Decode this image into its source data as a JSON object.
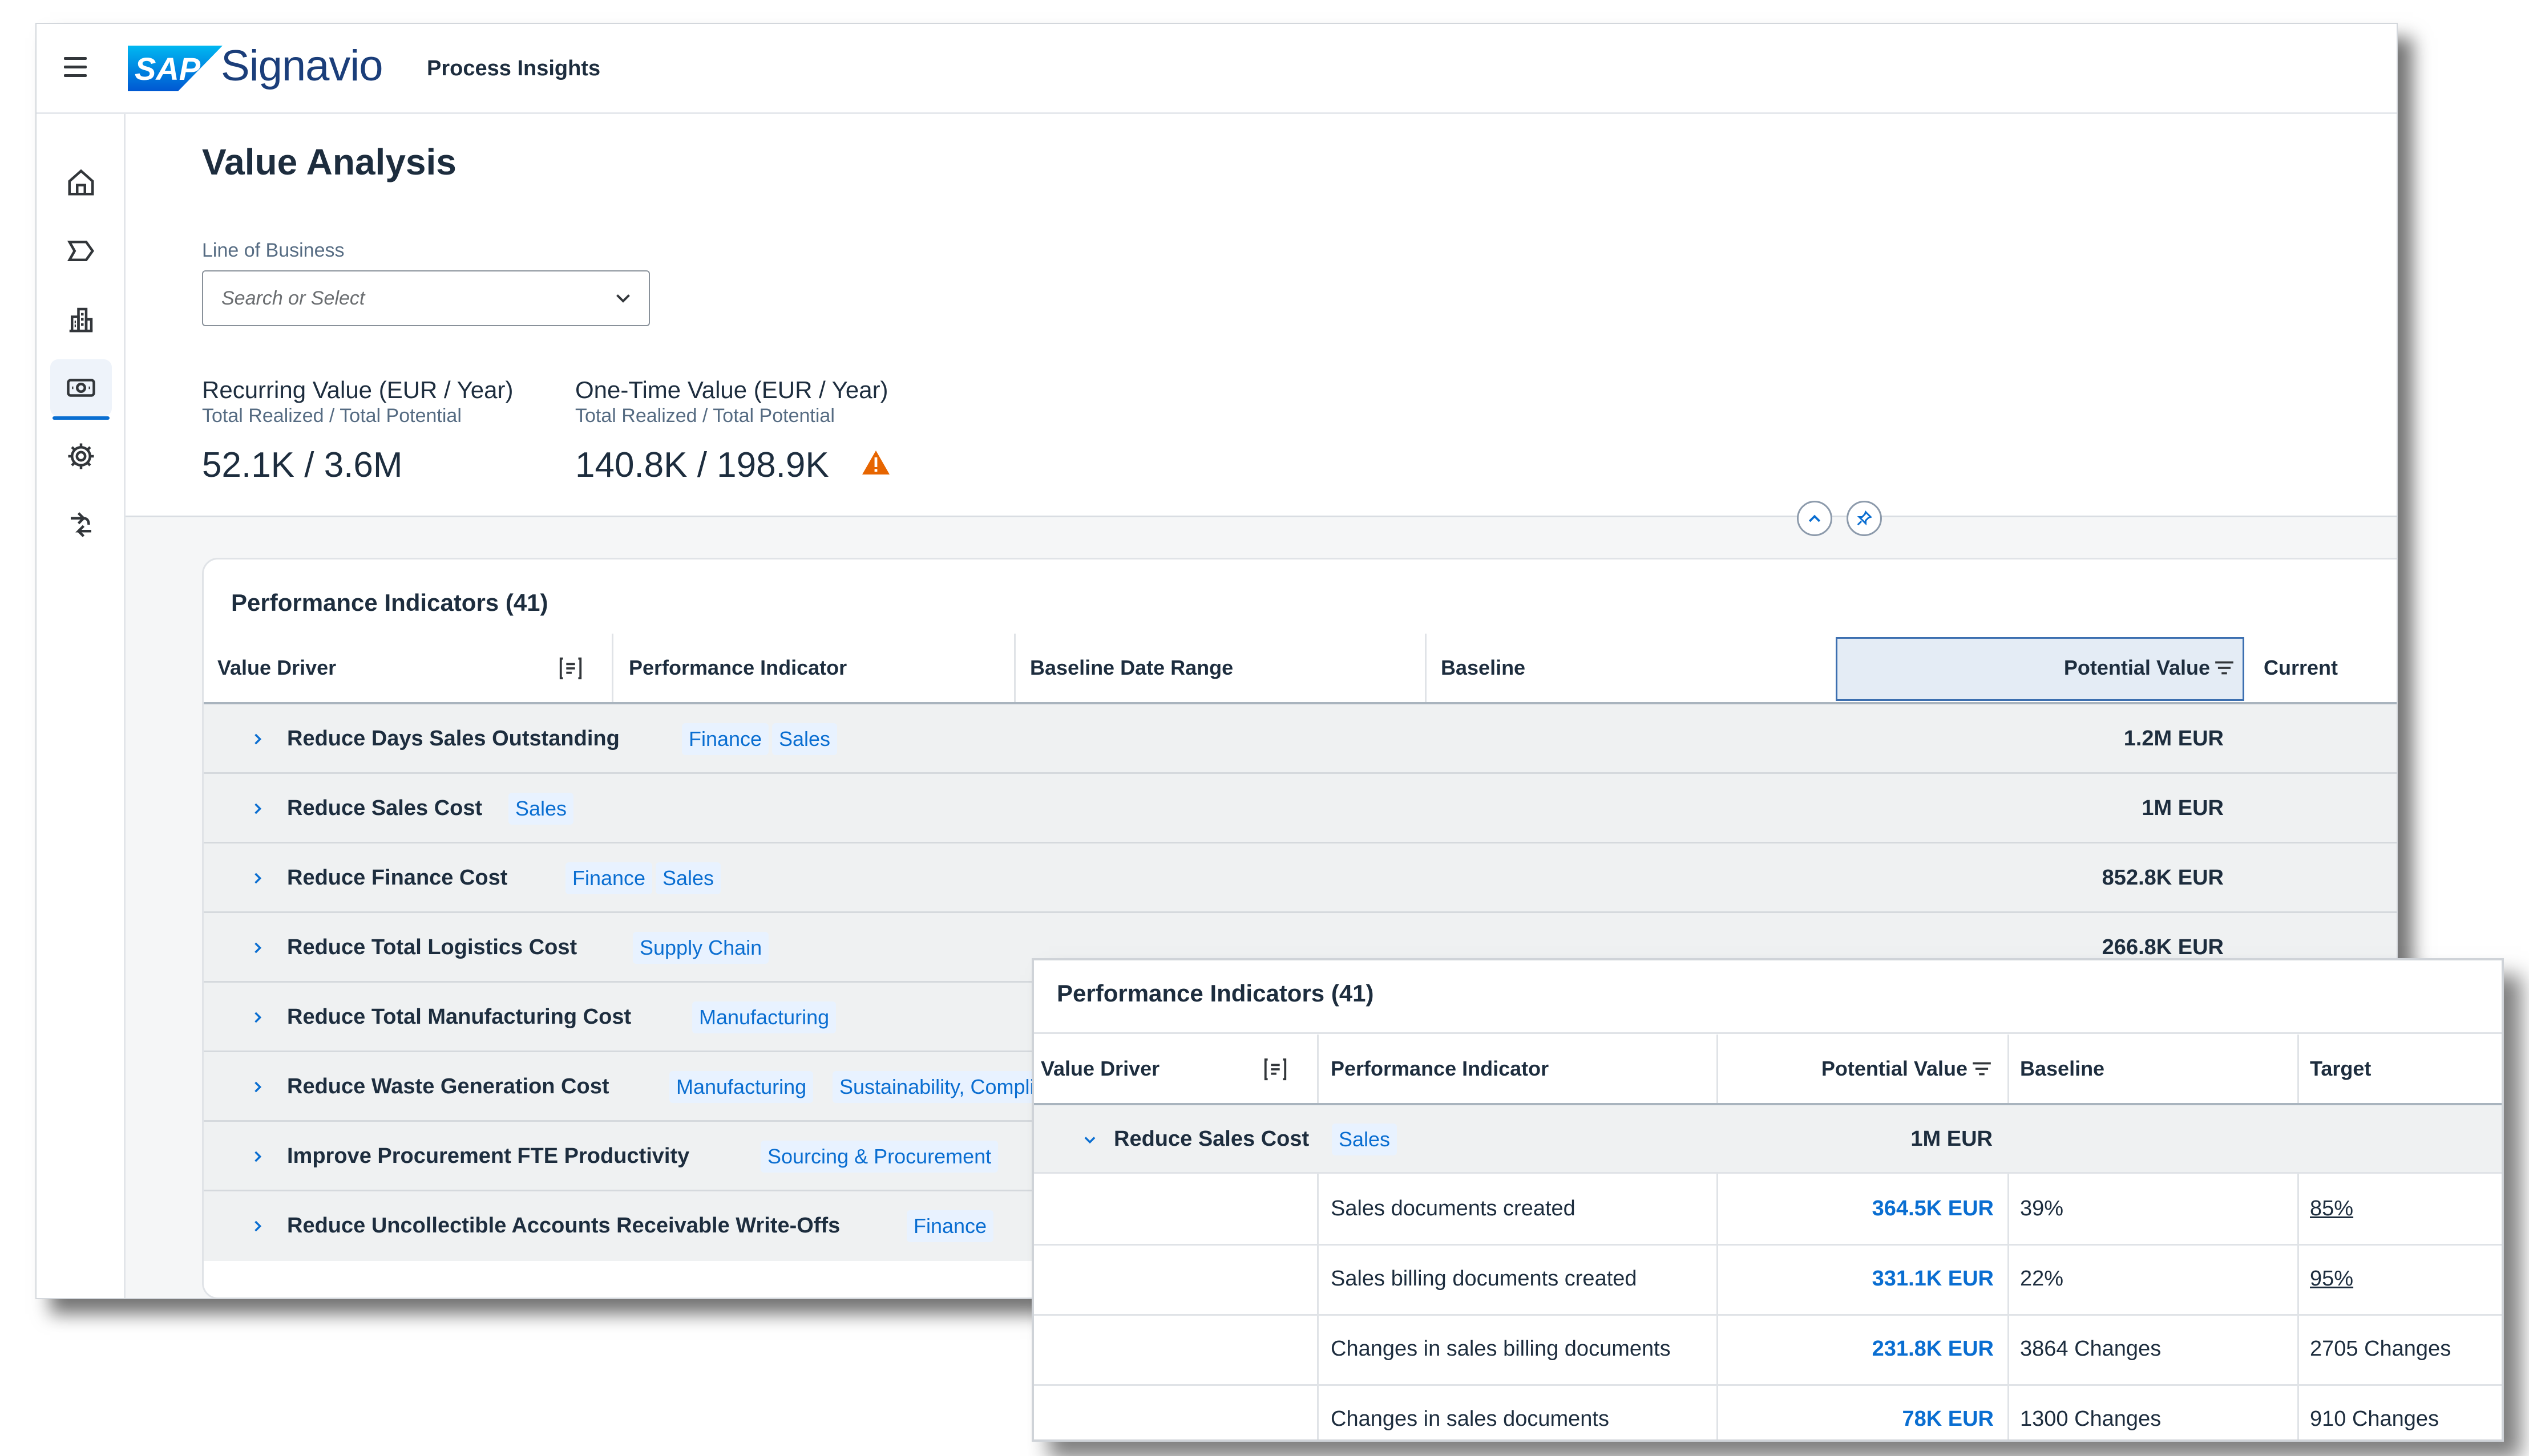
{
  "shell": {
    "sap_logo_text": "SAP",
    "wordmark": "Signavio",
    "product": "Process Insights"
  },
  "nav": {
    "items": [
      "home-icon",
      "process-icon",
      "buildings-icon",
      "value-icon",
      "gear-icon",
      "transfer-icon"
    ],
    "active": "value-icon"
  },
  "page": {
    "title": "Value Analysis",
    "line_of_business": {
      "label": "Line of Business",
      "placeholder": "Search or Select"
    }
  },
  "kpis": [
    {
      "title": "Recurring Value (EUR / Year)",
      "subtitle": "Total Realized / Total Potential",
      "value": "52.1K / 3.6M"
    },
    {
      "title": "One-Time Value (EUR / Year)",
      "subtitle": "Total Realized / Total Potential",
      "value": "140.8K / 198.9K",
      "warning": true
    }
  ],
  "table_main": {
    "title": "Performance Indicators (41)",
    "columns": [
      "Value Driver",
      "Performance Indicator",
      "Baseline Date Range",
      "Baseline",
      "Potential Value",
      "Current"
    ],
    "rows": [
      {
        "driver": "Reduce Days Sales Outstanding",
        "tags": [
          "Finance",
          "Sales"
        ],
        "potential": "1.2M EUR"
      },
      {
        "driver": "Reduce Sales Cost",
        "tags": [
          "Sales"
        ],
        "potential": "1M EUR"
      },
      {
        "driver": "Reduce Finance Cost",
        "tags": [
          "Finance",
          "Sales"
        ],
        "potential": "852.8K EUR"
      },
      {
        "driver": "Reduce Total Logistics Cost",
        "tags": [
          "Supply Chain"
        ],
        "potential": "266.8K EUR"
      },
      {
        "driver": "Reduce Total Manufacturing Cost",
        "tags": [
          "Manufacturing"
        ],
        "potential": ""
      },
      {
        "driver": "Reduce Waste Generation Cost",
        "tags": [
          "Manufacturing",
          "Sustainability, Complian"
        ],
        "potential": ""
      },
      {
        "driver": "Improve Procurement FTE Productivity",
        "tags": [
          "Sourcing & Procurement"
        ],
        "potential": ""
      },
      {
        "driver": "Reduce Uncollectible Accounts Receivable Write-Offs",
        "tags": [
          "Finance"
        ],
        "potential": ""
      }
    ]
  },
  "table_overlay": {
    "title": "Performance Indicators (41)",
    "columns": [
      "Value Driver",
      "Performance Indicator",
      "Potential Value",
      "Baseline",
      "Target"
    ],
    "group": {
      "driver": "Reduce Sales Cost",
      "tag": "Sales",
      "potential": "1M EUR"
    },
    "rows": [
      {
        "indicator": "Sales documents created",
        "potential": "364.5K EUR",
        "baseline": "39%",
        "target": "85%",
        "target_link": true
      },
      {
        "indicator": "Sales billing documents created",
        "potential": "331.1K EUR",
        "baseline": "22%",
        "target": "95%",
        "target_link": true
      },
      {
        "indicator": "Changes in sales billing documents",
        "potential": "231.8K EUR",
        "baseline": "3864 Changes",
        "target": "2705 Changes",
        "target_link": false
      },
      {
        "indicator": "Changes in sales documents",
        "potential": "78K EUR",
        "baseline": "1300 Changes",
        "target": "910 Changes",
        "target_link": false
      }
    ]
  },
  "colors": {
    "accent": "#0a6ed1",
    "tag_bg": "#e8f2ff",
    "warning": "#e76500",
    "brand_blue": "#1b3e7a"
  }
}
